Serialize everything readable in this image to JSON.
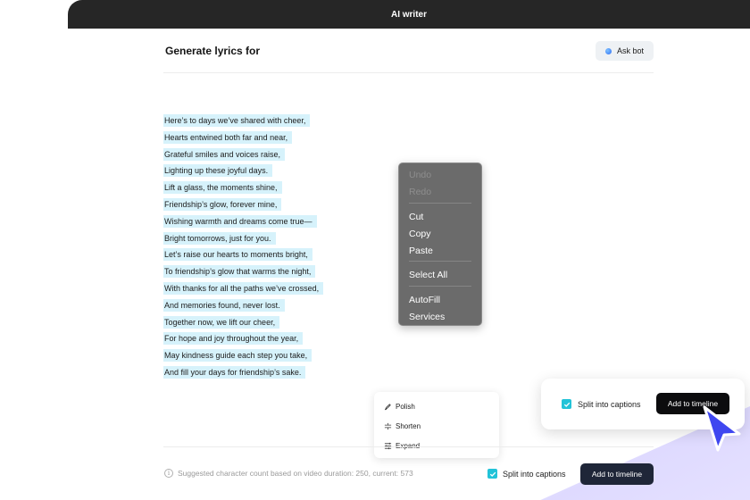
{
  "window": {
    "title": "AI writer"
  },
  "header": {
    "title": "Generate lyrics for",
    "ask_bot_label": "Ask bot"
  },
  "lyrics": [
    "Here’s to days we’ve shared with cheer,",
    "Hearts entwined both far and near,",
    "Grateful smiles and voices raise,",
    "Lighting up these joyful days.",
    "Lift a glass, the moments shine,",
    "Friendship’s glow, forever mine,",
    "Wishing warmth and dreams come true—",
    "Bright tomorrows, just for you.",
    "Let’s raise our hearts to moments bright,",
    "To friendship’s glow that warms the night,",
    "With thanks for all the paths we’ve crossed,",
    "And memories found, never lost.",
    "Together now, we lift our cheer,",
    "For hope and joy throughout the year,",
    "May kindness guide each step you take,",
    "And fill your days for friendship’s sake."
  ],
  "context_menu": {
    "undo": "Undo",
    "redo": "Redo",
    "cut": "Cut",
    "copy": "Copy",
    "paste": "Paste",
    "select_all": "Select All",
    "autofill": "AutoFill",
    "services": "Services"
  },
  "edit_menu": {
    "polish": "Polish",
    "shorten": "Shorten",
    "expand": "Expand"
  },
  "footer": {
    "hint": "Suggested character count based on video duration: 250, current: 573",
    "split_label": "Split into captions",
    "add_label": "Add to timeline"
  },
  "callout": {
    "split_label": "Split into captions",
    "add_label": "Add to timeline"
  },
  "colors": {
    "highlight": "#d6f2fb",
    "checkbox": "#22c3d8",
    "titlebar": "#262626",
    "cursor": "#3f47f0"
  }
}
